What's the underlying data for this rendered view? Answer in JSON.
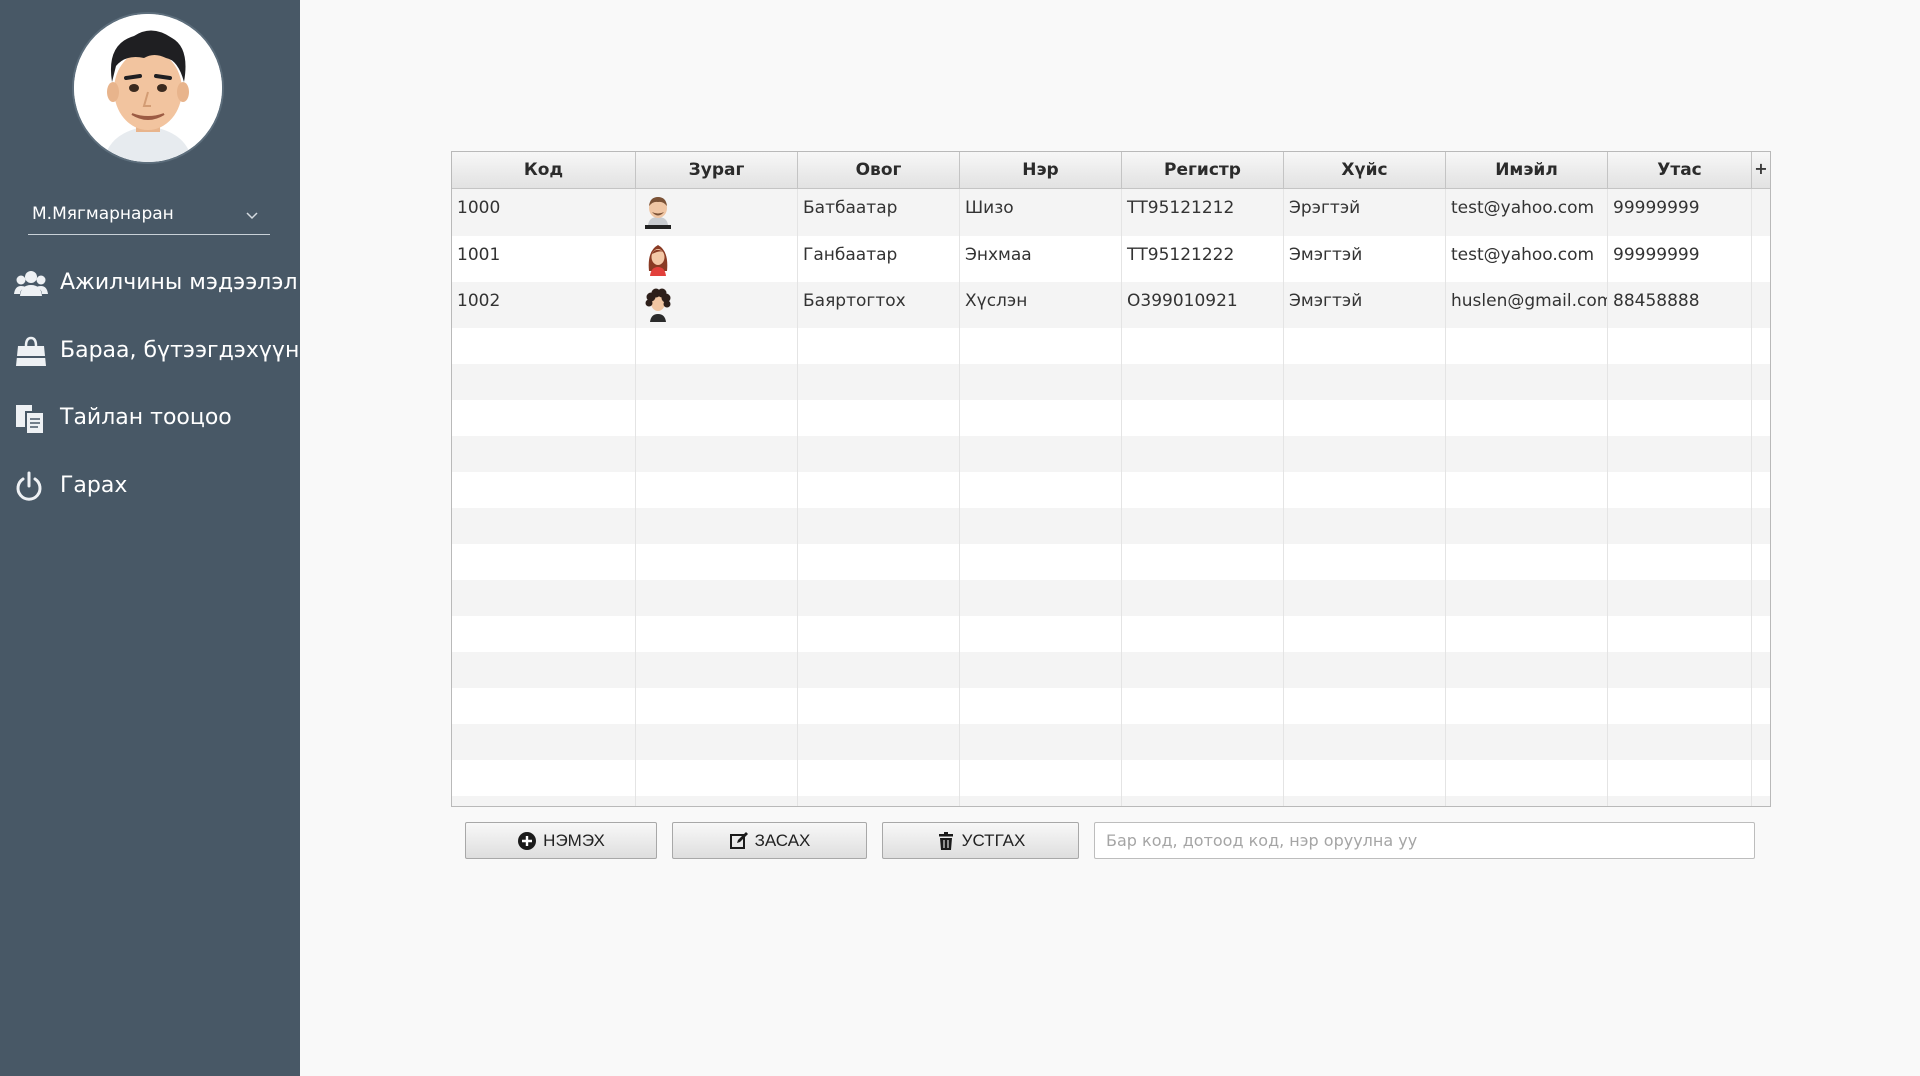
{
  "sidebar": {
    "user": {
      "name": "М.Мягмарнаран"
    },
    "menu": [
      {
        "label": "Ажилчины  мэдээлэл",
        "icon": "users-icon"
      },
      {
        "label": "Бараа, бүтээгдэхүүн",
        "icon": "shopping-bag-icon"
      },
      {
        "label": "Тайлан тооцоо",
        "icon": "documents-icon"
      },
      {
        "label": "Гарах",
        "icon": "power-icon"
      }
    ]
  },
  "table": {
    "columns": [
      "Код",
      "Зураг",
      "Овог",
      "Нэр",
      "Регистр",
      "Хүйс",
      "Имэйл",
      "Утас"
    ],
    "add_column_symbol": "+",
    "rows": [
      {
        "code": "1000",
        "photo": "male-avatar-icon",
        "surname": "Батбаатар",
        "name": "Шизо",
        "register": "ТТ95121212",
        "gender": "Эрэгтэй",
        "email": "test@yahoo.com",
        "phone": "99999999"
      },
      {
        "code": "1001",
        "photo": "female-avatar-icon",
        "surname": "Ганбаатар",
        "name": "Энхмаа",
        "register": "ТТ95121222",
        "gender": "Эмэгтэй",
        "email": "test@yahoo.com",
        "phone": "99999999"
      },
      {
        "code": "1002",
        "photo": "curly-avatar-icon",
        "surname": "Баяртогтох",
        "name": "Хүслэн",
        "register": "О399010921",
        "gender": "Эмэгтэй",
        "email": "huslen@gmail.com",
        "phone": "88458888"
      }
    ]
  },
  "actions": {
    "add_label": "НЭМЭХ",
    "edit_label": "ЗАСАХ",
    "delete_label": "УСТГАХ"
  },
  "search": {
    "placeholder": "Бар код, дотоод код, нэр оруулна уу",
    "value": ""
  },
  "colors": {
    "sidebar_bg": "#485866",
    "page_bg": "#f9f9f9",
    "row_alt": "#f4f4f4"
  }
}
